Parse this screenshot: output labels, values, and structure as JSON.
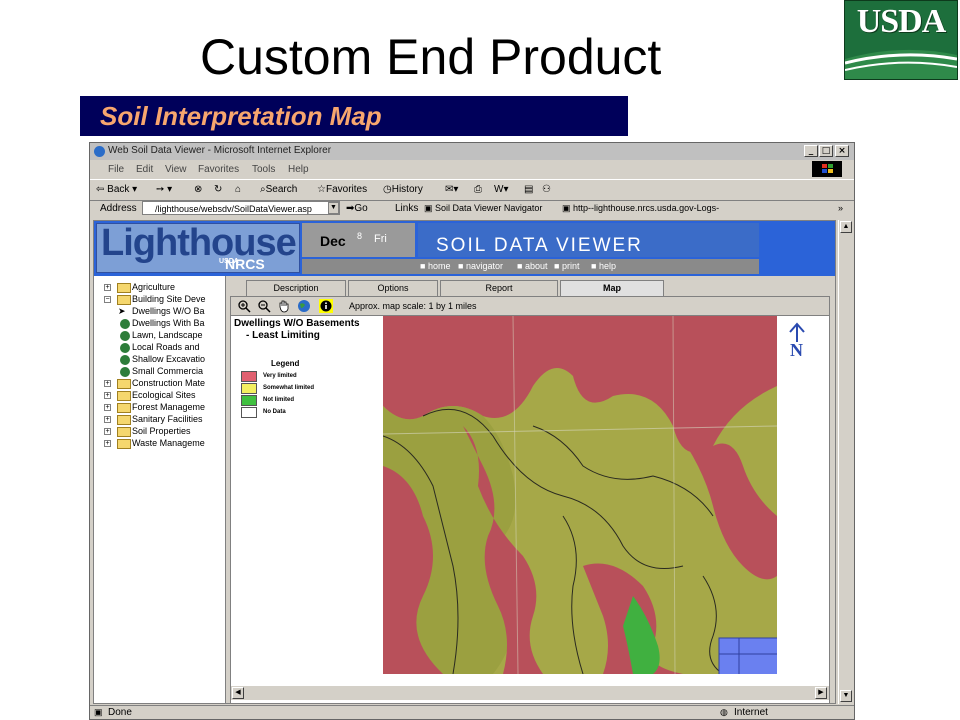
{
  "slide": {
    "title": "Custom End Product",
    "subtitle": "Soil Interpretation Map",
    "logo_text": "USDA"
  },
  "browser": {
    "title": "Web Soil Data Viewer - Microsoft Internet Explorer",
    "menu": [
      "File",
      "Edit",
      "View",
      "Favorites",
      "Tools",
      "Help"
    ],
    "toolbar": {
      "back": "Back",
      "search": "Search",
      "favorites": "Favorites",
      "history": "History"
    },
    "address_label": "Address",
    "address_value": "/lighthouse/websdv/SoilDataViewer.asp",
    "go_label": "Go",
    "links_label": "Links",
    "link1": "Soil Data Viewer Navigator",
    "link2": "http--lighthouse.nrcs.usda.gov-Logs-",
    "status": "Done",
    "zone": "Internet"
  },
  "site": {
    "logo": "Lighthouse",
    "logo_sub": "NRCS",
    "logo_usda": "USDA",
    "date_month": "Dec",
    "date_day": "8",
    "date_weekday": "Fri",
    "banner": "SOIL DATA VIEWER",
    "nav": [
      "home",
      "navigator",
      "about",
      "print",
      "help"
    ]
  },
  "tree": [
    {
      "label": "Agriculture",
      "exp": "+",
      "icon": "folder"
    },
    {
      "label": "Building Site Deve",
      "exp": "−",
      "icon": "folder"
    },
    {
      "label": "Dwellings W/O Ba",
      "exp": "",
      "icon": "arrow"
    },
    {
      "label": "Dwellings With Ba",
      "exp": "",
      "icon": "globe"
    },
    {
      "label": "Lawn, Landscape",
      "exp": "",
      "icon": "globe"
    },
    {
      "label": "Local Roads and",
      "exp": "",
      "icon": "globe"
    },
    {
      "label": "Shallow Excavatio",
      "exp": "",
      "icon": "globe"
    },
    {
      "label": "Small Commercia",
      "exp": "",
      "icon": "globe"
    },
    {
      "label": "Construction Mate",
      "exp": "+",
      "icon": "folder"
    },
    {
      "label": "Ecological Sites",
      "exp": "+",
      "icon": "folder"
    },
    {
      "label": "Forest Manageme",
      "exp": "+",
      "icon": "folder"
    },
    {
      "label": "Sanitary Facilities",
      "exp": "+",
      "icon": "folder"
    },
    {
      "label": "Soil Properties",
      "exp": "+",
      "icon": "folder"
    },
    {
      "label": "Waste Manageme",
      "exp": "+",
      "icon": "folder"
    }
  ],
  "tabs": [
    "Description",
    "Options",
    "Report",
    "Map"
  ],
  "map": {
    "scale": "Approx. map scale: 1 by 1 miles",
    "title_line1": "Dwellings W/O Basements",
    "title_line2": "- Least Limiting",
    "legend_title": "Legend",
    "legend": [
      {
        "label": "Very limited",
        "color": "#e06070"
      },
      {
        "label": "Somewhat limited",
        "color": "#f4f060"
      },
      {
        "label": "Not limited",
        "color": "#40c040"
      },
      {
        "label": "No Data",
        "color": "#ffffff"
      }
    ],
    "north": "N"
  }
}
